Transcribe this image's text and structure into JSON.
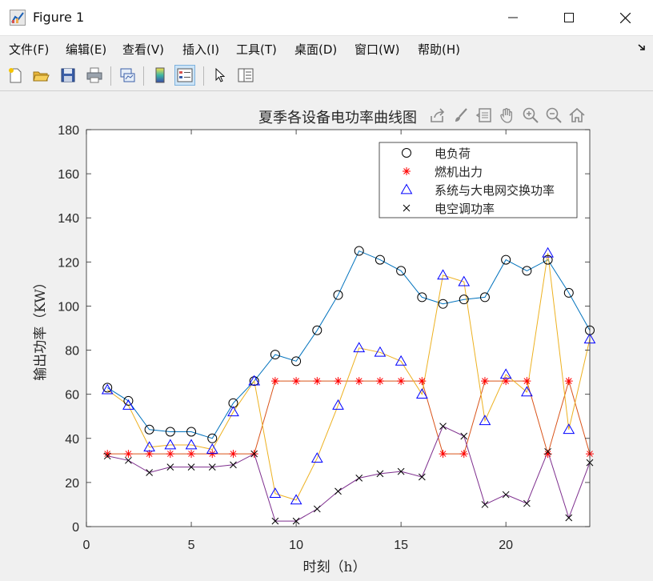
{
  "window": {
    "title": "Figure 1"
  },
  "menu": {
    "items": [
      "文件(F)",
      "编辑(E)",
      "查看(V)",
      "插入(I)",
      "工具(T)",
      "桌面(D)",
      "窗口(W)",
      "帮助(H)"
    ]
  },
  "toolbar": {
    "icons": [
      "new-figure-icon",
      "open-file-icon",
      "save-icon",
      "print-icon",
      "link-plot-icon",
      "colorbar-icon",
      "legend-icon",
      "pointer-icon",
      "property-inspector-icon"
    ]
  },
  "axes_toolbar": {
    "icons": [
      "export-icon",
      "brush-icon",
      "data-tips-icon",
      "pan-icon",
      "zoom-in-icon",
      "zoom-out-icon",
      "home-icon"
    ]
  },
  "chart_data": {
    "type": "line",
    "title": "夏季各设备电功率曲线图",
    "xlabel": "时刻（h）",
    "ylabel": "输出功率（KW）",
    "xlim": [
      0,
      24
    ],
    "ylim": [
      0,
      180
    ],
    "xticks": [
      0,
      5,
      10,
      15,
      20
    ],
    "yticks": [
      0,
      20,
      40,
      60,
      80,
      100,
      120,
      140,
      160,
      180
    ],
    "grid": false,
    "legend_position": "top-right",
    "x": [
      1,
      2,
      3,
      4,
      5,
      6,
      7,
      8,
      9,
      10,
      11,
      12,
      13,
      14,
      15,
      16,
      17,
      18,
      19,
      20,
      21,
      22,
      23,
      24
    ],
    "series": [
      {
        "name": "电负荷",
        "marker": "circle",
        "marker_color": "#000000",
        "line_color": "#0072BD",
        "values": [
          63,
          57,
          44,
          43,
          43,
          40,
          56,
          66,
          78,
          75,
          89,
          105,
          125,
          121,
          116,
          104,
          101,
          103,
          104,
          121,
          116,
          121,
          106,
          89
        ]
      },
      {
        "name": "燃机出力",
        "marker": "asterisk",
        "marker_color": "#ff0000",
        "line_color": "#D95319",
        "values": [
          33,
          33,
          33,
          33,
          33,
          33,
          33,
          33,
          66,
          66,
          66,
          66,
          66,
          66,
          66,
          66,
          33,
          33,
          66,
          66,
          66,
          33,
          66,
          33
        ]
      },
      {
        "name": "系统与大电网交换功率",
        "marker": "triangle",
        "marker_color": "#0000ff",
        "line_color": "#EDB120",
        "values": [
          62,
          55,
          36,
          37,
          37,
          35,
          52,
          66,
          15,
          12,
          31,
          55,
          81,
          79,
          75,
          60,
          114,
          111,
          48,
          69,
          61,
          124,
          44,
          85
        ]
      },
      {
        "name": "电空调功率",
        "marker": "x",
        "marker_color": "#000000",
        "line_color": "#7E2F8E",
        "values": [
          32,
          30,
          24.5,
          27,
          27,
          27,
          28,
          33,
          2.5,
          2.5,
          8,
          16,
          22,
          24,
          25,
          22.5,
          45.5,
          41,
          10,
          14.5,
          10.5,
          34,
          4,
          29
        ]
      }
    ]
  }
}
